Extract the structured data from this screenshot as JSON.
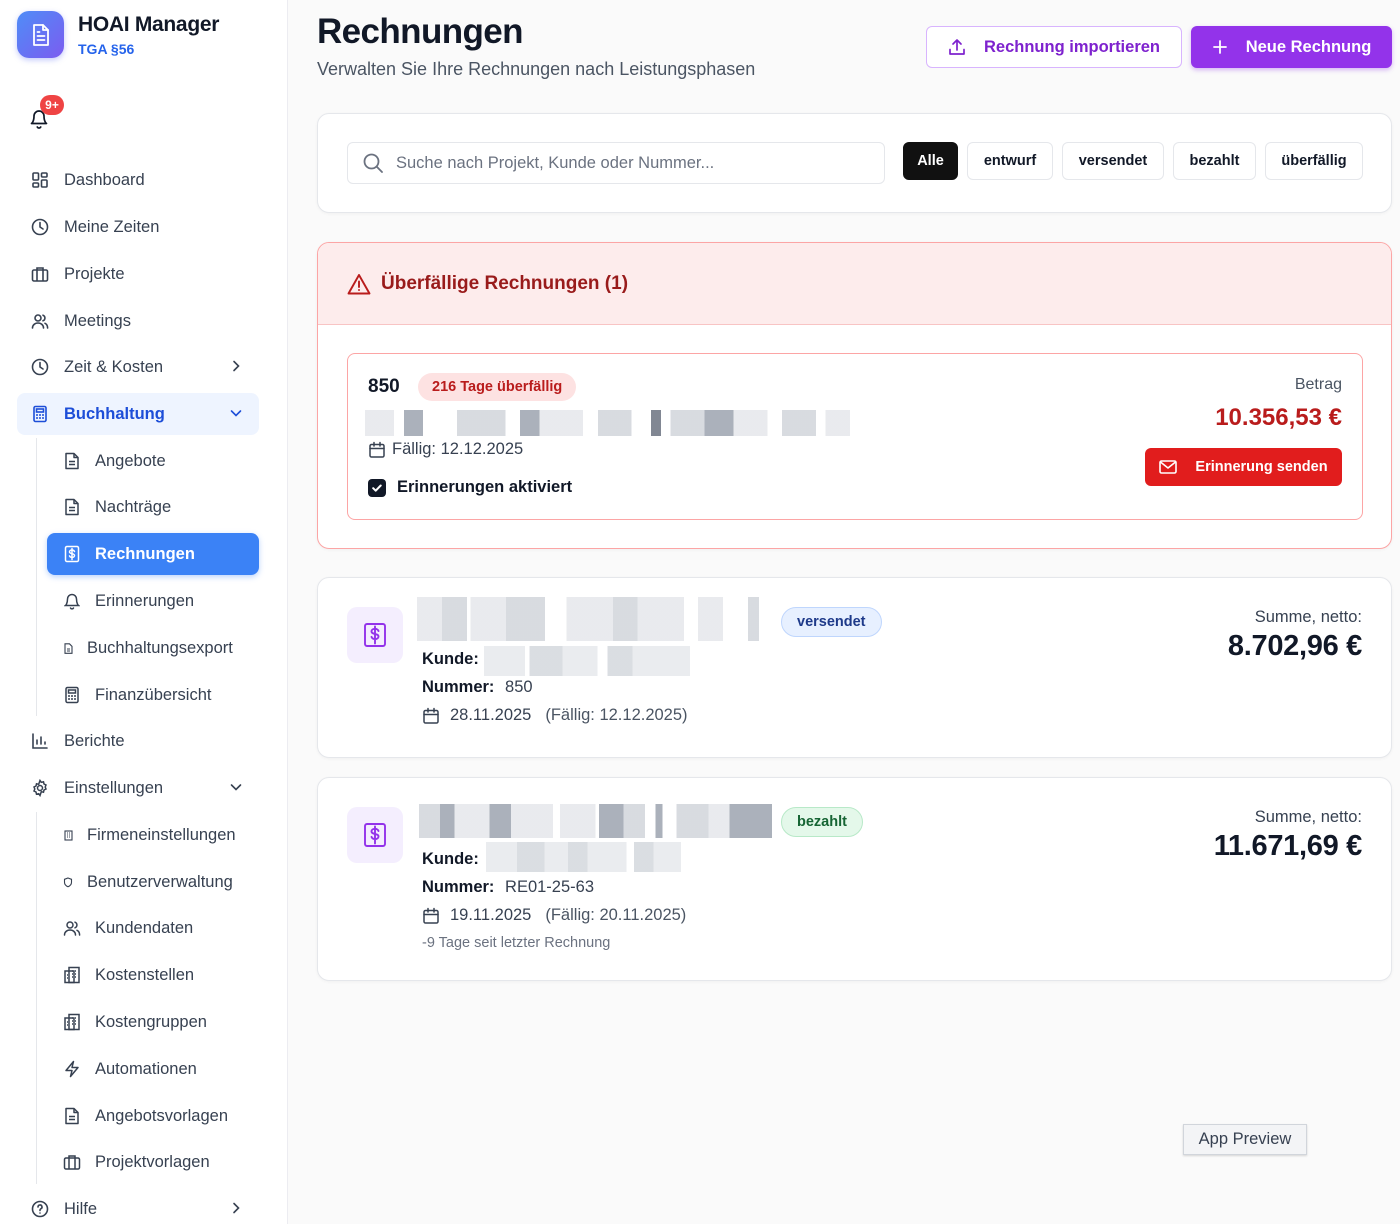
{
  "brand": {
    "title": "HOAI Manager",
    "subtitle": "TGA §56",
    "accent": "#2563eb"
  },
  "notifications": {
    "badge": "9+"
  },
  "sidebar": {
    "items": [
      {
        "label": "Dashboard",
        "icon": "dashboard-icon"
      },
      {
        "label": "Meine Zeiten",
        "icon": "clock-icon"
      },
      {
        "label": "Projekte",
        "icon": "briefcase-icon"
      },
      {
        "label": "Meetings",
        "icon": "users-icon"
      },
      {
        "label": "Zeit & Kosten",
        "icon": "clock-icon"
      },
      {
        "label": "Buchhaltung",
        "icon": "calculator-icon"
      },
      {
        "label": "Berichte",
        "icon": "bar-chart-icon"
      },
      {
        "label": "Einstellungen",
        "icon": "gear-icon"
      },
      {
        "label": "Hilfe",
        "icon": "help-circle-icon"
      }
    ],
    "buchhaltung_sub": [
      {
        "label": "Angebote"
      },
      {
        "label": "Nachträge"
      },
      {
        "label": "Rechnungen"
      },
      {
        "label": "Erinnerungen"
      },
      {
        "label": "Buchhaltungsexport"
      },
      {
        "label": "Finanzübersicht"
      }
    ],
    "einstellungen_sub": [
      {
        "label": "Firmeneinstellungen"
      },
      {
        "label": "Benutzerverwaltung"
      },
      {
        "label": "Kundendaten"
      },
      {
        "label": "Kostenstellen"
      },
      {
        "label": "Kostengruppen"
      },
      {
        "label": "Automationen"
      },
      {
        "label": "Angebotsvorlagen"
      },
      {
        "label": "Projektvorlagen"
      }
    ]
  },
  "header": {
    "title": "Rechnungen",
    "subtitle": "Verwalten Sie Ihre Rechnungen nach Leistungsphasen",
    "import_label": "Rechnung importieren",
    "new_label": "Neue Rechnung"
  },
  "search": {
    "placeholder": "Suche nach Projekt, Kunde oder Nummer...",
    "value": "",
    "filters": [
      "Alle",
      "entwurf",
      "versendet",
      "bezahlt",
      "überfällig"
    ],
    "active_filter": "Alle"
  },
  "overdue": {
    "title": "Überfällige Rechnungen (1)",
    "item": {
      "number": "850",
      "badge": "216 Tage überfällig",
      "due": "Fällig: 12.12.2025",
      "reminders_label": "Erinnerungen aktiviert",
      "reminders_checked": true,
      "amount_label": "Betrag",
      "amount": "10.356,53 €",
      "remind_button": "Erinnerung senden"
    }
  },
  "invoices": [
    {
      "status": "versendet",
      "kunde_label": "Kunde:",
      "nummer_label": "Nummer:",
      "nummer": "850",
      "date": "28.11.2025",
      "due": "(Fällig: 12.12.2025)",
      "sum_label": "Summe, netto:",
      "sum": "8.702,96 €"
    },
    {
      "status": "bezahlt",
      "kunde_label": "Kunde:",
      "nummer_label": "Nummer:",
      "nummer": "RE01-25-63",
      "date": "19.11.2025",
      "due": "(Fällig: 20.11.2025)",
      "note": "-9 Tage seit letzter Rechnung",
      "sum_label": "Summe, netto:",
      "sum": "11.671,69 €"
    }
  ],
  "footer": {
    "preview_label": "App Preview"
  },
  "colors": {
    "active_nav": "#3b82f6",
    "primary_purple": "#9333ea",
    "overdue_red": "#b91c1c",
    "danger_button": "#e11d1d"
  }
}
